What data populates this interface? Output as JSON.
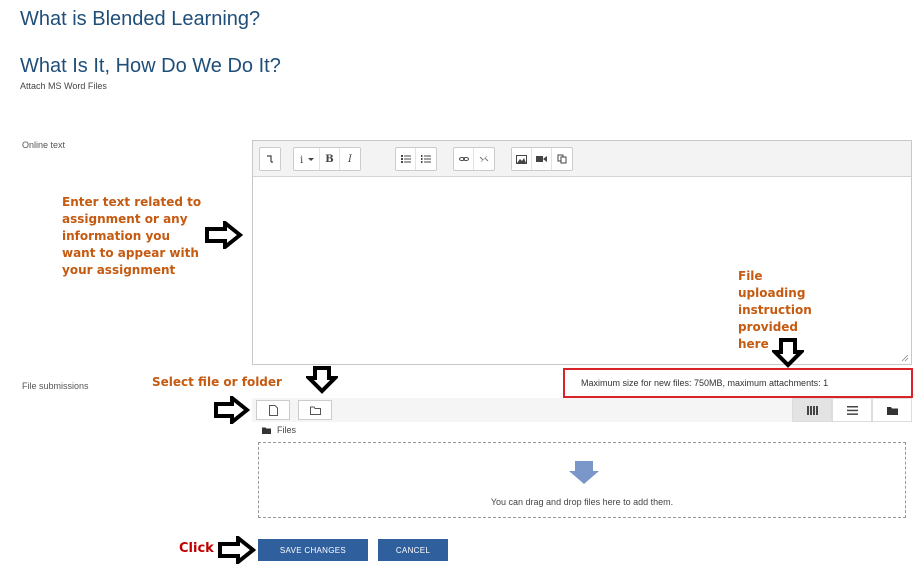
{
  "page": {
    "title": "What is Blended Learning?",
    "subtitle": "What Is It, How Do We Do It?",
    "description": "Attach MS Word Files"
  },
  "online_text": {
    "label": "Online text",
    "toolbar_icons": [
      "paragraph-icon",
      "info-dropdown-icon",
      "bold-icon",
      "italic-icon",
      "unordered-list-icon",
      "ordered-list-icon",
      "link-icon",
      "unlink-icon",
      "image-icon",
      "video-icon",
      "special-char-icon"
    ],
    "bold_glyph": "B",
    "italic_glyph": "I"
  },
  "file_submissions": {
    "label": "File submissions",
    "info": "Maximum size for new files: 750MB, maximum attachments: 1",
    "path_label": "Files",
    "drop_text": "You can drag and drop files here to add them."
  },
  "annotations": {
    "online_text_lines": [
      "Enter text related to",
      "assignment or any",
      "information you",
      "want to appear with",
      "your assignment"
    ],
    "upload_lines": [
      "File",
      "uploading",
      "instruction",
      "provided",
      "here"
    ],
    "select_file": "Select file or folder",
    "click": "Click"
  },
  "buttons": {
    "save": "SAVE CHANGES",
    "cancel": "CANCEL"
  },
  "colors": {
    "heading": "#1f4e79",
    "annotation": "#c55a11",
    "highlight_box": "#d9232a",
    "button": "#2f5f9c"
  }
}
